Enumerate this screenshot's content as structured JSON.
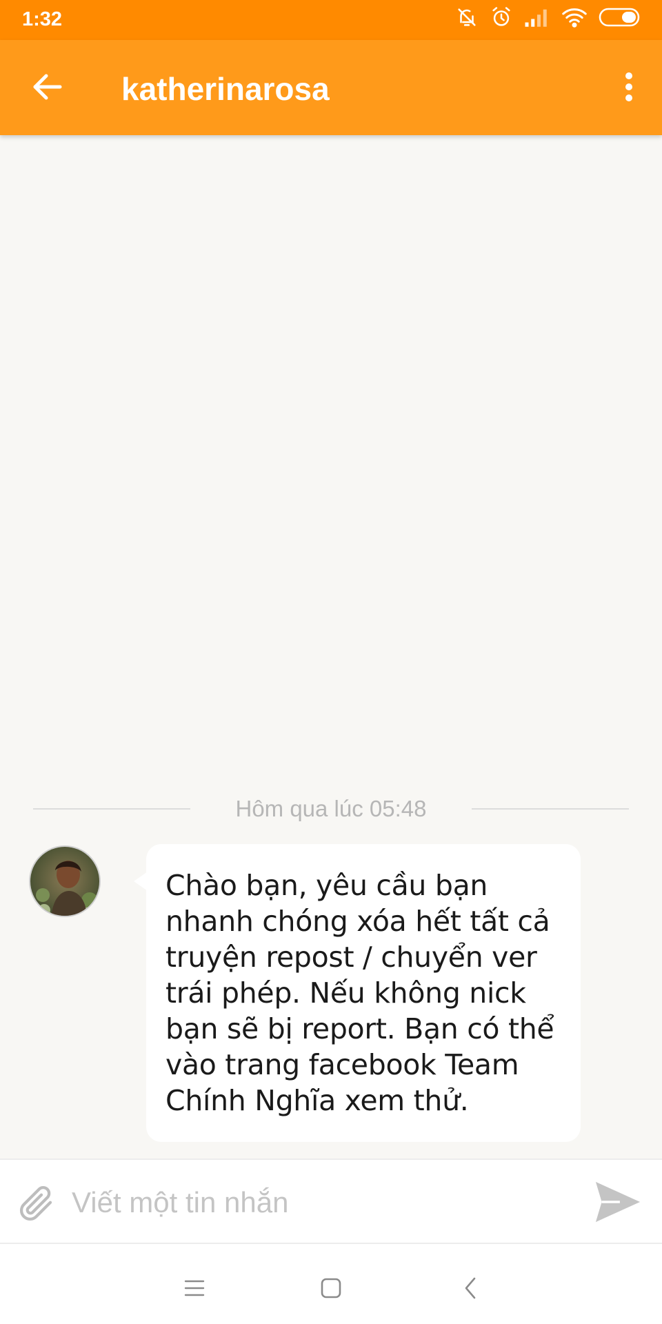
{
  "status_bar": {
    "time": "1:32",
    "icons": [
      "mute-icon",
      "alarm-icon",
      "signal-icon",
      "wifi-icon",
      "battery-icon"
    ]
  },
  "app_bar": {
    "title": "katherinarosa",
    "back_icon": "arrow-left-icon",
    "more_icon": "more-vert-icon",
    "color": "#ff9a1a"
  },
  "conversation": {
    "date_divider": "Hôm qua lúc 05:48",
    "messages": [
      {
        "sender": "katherinarosa",
        "avatar": "avatar",
        "text": "Chào bạn, yêu cầu bạn nhanh chóng xóa hết tất cả truyện repost / chuyển ver trái phép. Nếu không nick bạn sẽ bị report. Bạn có thể vào trang facebook Team Chính Nghĩa xem thử."
      }
    ]
  },
  "composer": {
    "placeholder": "Viết một tin nhắn",
    "value": "",
    "attach_icon": "paperclip-icon",
    "send_icon": "send-icon"
  },
  "nav_bar": {
    "buttons": [
      "menu-icon",
      "home-icon",
      "back-icon"
    ]
  },
  "colors": {
    "status_bar": "#ff8a00",
    "app_bar": "#ff9a1a",
    "background": "#f8f7f4"
  }
}
